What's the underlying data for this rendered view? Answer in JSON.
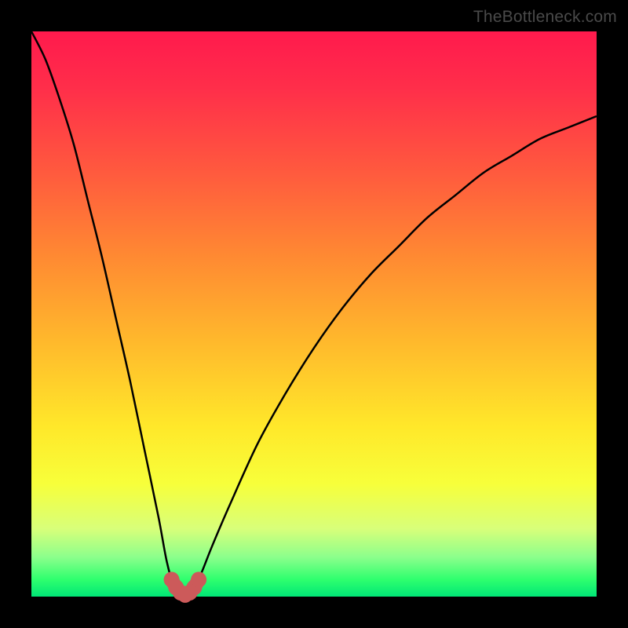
{
  "credit": "TheBottleneck.com",
  "colors": {
    "frame": "#000000",
    "curve": "#000000",
    "marker": "#cc5a5a",
    "gradient_top": "#ff1a4d",
    "gradient_bottom": "#00e676"
  },
  "chart_data": {
    "type": "line",
    "title": "",
    "xlabel": "",
    "ylabel": "",
    "xlim": [
      0,
      100
    ],
    "ylim": [
      0,
      100
    ],
    "series": [
      {
        "name": "bottleneck-curve",
        "x": [
          0,
          2.5,
          5,
          7.5,
          10,
          12.5,
          15,
          17.5,
          20,
          22.5,
          24,
          25.5,
          27,
          28.5,
          30,
          32,
          35,
          40,
          45,
          50,
          55,
          60,
          65,
          70,
          75,
          80,
          85,
          90,
          95,
          100
        ],
        "values": [
          100,
          95,
          88,
          80,
          70,
          60,
          49,
          38,
          26,
          14,
          6,
          1,
          0,
          1,
          4,
          9,
          16,
          27,
          36,
          44,
          51,
          57,
          62,
          67,
          71,
          75,
          78,
          81,
          83,
          85
        ]
      }
    ],
    "optimum_x": 27,
    "markers": {
      "x": [
        24.8,
        25.6,
        26.4,
        27.2,
        28.0,
        28.8,
        29.6
      ],
      "values": [
        3.0,
        1.6,
        0.7,
        0.3,
        0.7,
        1.6,
        3.0
      ]
    }
  }
}
